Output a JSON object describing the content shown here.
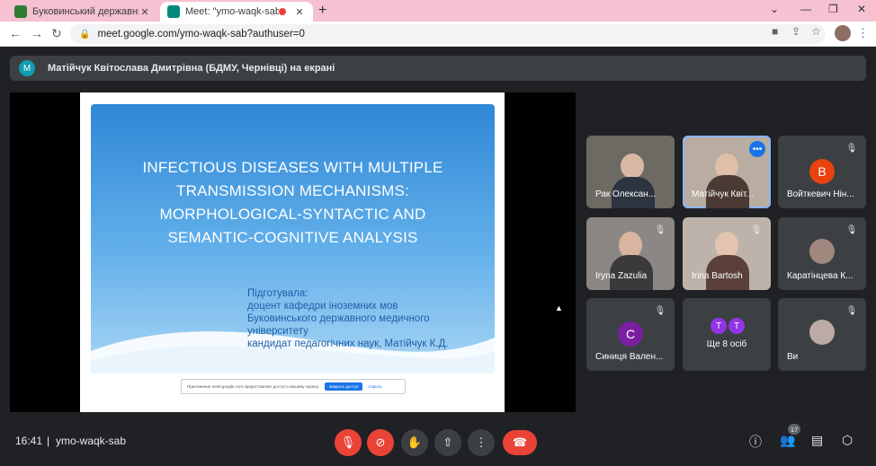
{
  "browser": {
    "tabs": [
      {
        "title": "Буковинський державний мед",
        "active": false
      },
      {
        "title": "Meet: \"ymo-waqk-sab\"",
        "active": true
      }
    ],
    "url": "meet.google.com/ymo-waqk-sab?authuser=0"
  },
  "presenter": {
    "initial": "M",
    "label": "Матійчук Квітослава Дмитрівна (БДМУ, Чернівці) на екрані"
  },
  "slide": {
    "title_lines": [
      "INFECTIOUS DISEASES WITH MULTIPLE",
      "TRANSMISSION MECHANISMS:",
      "MORPHOLOGICAL-SYNTACTIC AND",
      "SEMANTIC-COGNITIVE ANALYSIS"
    ],
    "body_lines": [
      "Підготувала:",
      "доцент кафедри іноземних мов",
      "Буковинського державного медичного",
      "університету",
      "кандидат педагогічних наук, Матійчук К.Д."
    ],
    "share_notice": "Приложение meet.google.com предоставляет доступ к вашему экрану.",
    "share_stop": "Закрыть доступ",
    "share_hide": "Скрыть"
  },
  "participants": [
    {
      "name": "Рак Олексан...",
      "type": "video"
    },
    {
      "name": "Матійчук Квіт...",
      "type": "video",
      "active": true
    },
    {
      "name": "Войткевич Нін...",
      "type": "avatar",
      "initial": "B",
      "color": "#e8430e"
    },
    {
      "name": "Iryna Zazulia",
      "type": "video"
    },
    {
      "name": "Irina Bartosh",
      "type": "video"
    },
    {
      "name": "Каратінцева К...",
      "type": "photo"
    },
    {
      "name": "Синиця Вален...",
      "type": "avatar",
      "initial": "C",
      "color": "#7b1fa2"
    },
    {
      "name": "Ще 8 осіб",
      "type": "more",
      "initials": [
        "T",
        "T"
      ]
    },
    {
      "name": "Ви",
      "type": "photo"
    }
  ],
  "bottom": {
    "time": "16:41",
    "separator": "|",
    "meeting_code": "ymo-waqk-sab",
    "people_count": "17"
  },
  "colors": {
    "background": "#202124",
    "tile": "#3c4043",
    "danger": "#ea4335",
    "accent": "#1a73e8"
  }
}
